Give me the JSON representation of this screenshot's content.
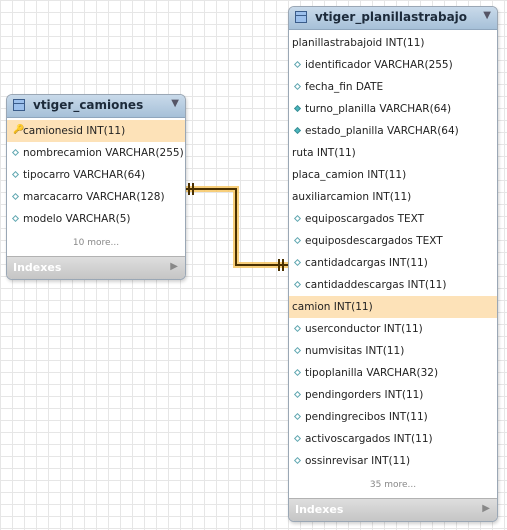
{
  "tables": [
    {
      "name": "vtiger_camiones",
      "columns": [
        {
          "text": "camionesid INT(11)",
          "marker": "key",
          "highlight": true
        },
        {
          "text": "nombrecamion VARCHAR(255)",
          "marker": "diamond"
        },
        {
          "text": "tipocarro VARCHAR(64)",
          "marker": "diamond"
        },
        {
          "text": "marcacarro VARCHAR(128)",
          "marker": "diamond"
        },
        {
          "text": "modelo VARCHAR(5)",
          "marker": "diamond"
        }
      ],
      "more": "10 more...",
      "indexes": "Indexes"
    },
    {
      "name": "vtiger_planillastrabajo",
      "columns": [
        {
          "text": "planillastrabajoid INT(11)",
          "marker": "none"
        },
        {
          "text": "identificador VARCHAR(255)",
          "marker": "diamond"
        },
        {
          "text": "fecha_fin DATE",
          "marker": "diamond"
        },
        {
          "text": "turno_planilla VARCHAR(64)",
          "marker": "diamond-filled"
        },
        {
          "text": "estado_planilla VARCHAR(64)",
          "marker": "diamond-filled"
        },
        {
          "text": "ruta INT(11)",
          "marker": "none"
        },
        {
          "text": "placa_camion INT(11)",
          "marker": "none"
        },
        {
          "text": "auxiliarcamion INT(11)",
          "marker": "none"
        },
        {
          "text": "equiposcargados TEXT",
          "marker": "diamond"
        },
        {
          "text": "equiposdescargados TEXT",
          "marker": "diamond"
        },
        {
          "text": "cantidadcargas INT(11)",
          "marker": "diamond"
        },
        {
          "text": "cantidaddescargas INT(11)",
          "marker": "diamond"
        },
        {
          "text": "camion INT(11)",
          "marker": "none",
          "highlight": true
        },
        {
          "text": "userconductor INT(11)",
          "marker": "diamond"
        },
        {
          "text": "numvisitas INT(11)",
          "marker": "diamond"
        },
        {
          "text": "tipoplanilla VARCHAR(32)",
          "marker": "diamond"
        },
        {
          "text": "pendingorders INT(11)",
          "marker": "diamond"
        },
        {
          "text": "pendingrecibos INT(11)",
          "marker": "diamond"
        },
        {
          "text": "activoscargados INT(11)",
          "marker": "diamond"
        },
        {
          "text": "ossinrevisar INT(11)",
          "marker": "diamond"
        }
      ],
      "more": "35 more...",
      "indexes": "Indexes"
    }
  ],
  "colors": {
    "header_blue": "#a6c0d8",
    "highlight_row": "#fde2b8",
    "relationship_line": "#5a3b00",
    "relationship_glow": "#f6c35a"
  }
}
